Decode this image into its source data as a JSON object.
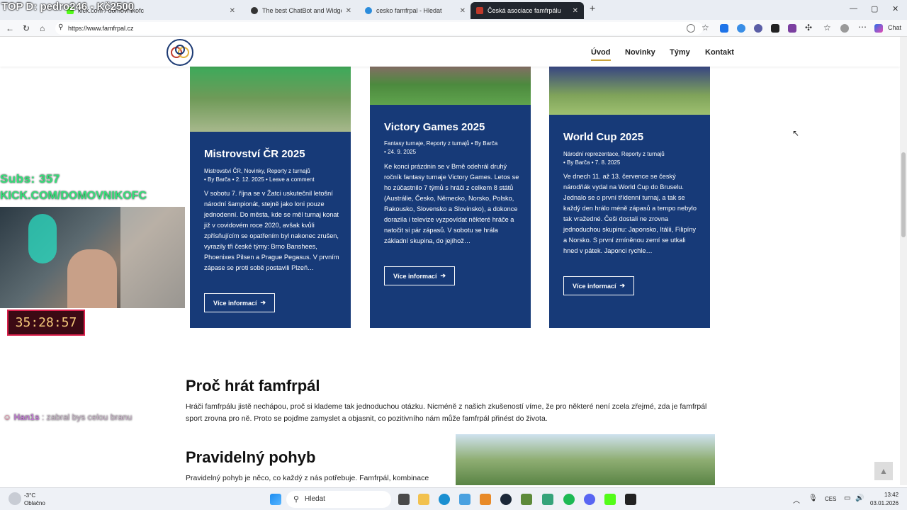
{
  "browser": {
    "tabs": [
      {
        "title": "kick.com / domovnikofc",
        "active": false
      },
      {
        "title": "The best ChatBot and Widgets fo",
        "active": false
      },
      {
        "title": "cesko famfrpal - Hledat",
        "active": false
      },
      {
        "title": "Česká asociace famfrpálu",
        "active": true
      }
    ],
    "new_tab": "+",
    "url": "https://www.famfrpal.cz",
    "chat_label": "Chat"
  },
  "site": {
    "menu": [
      "Úvod",
      "Novinky",
      "Týmy",
      "Kontakt"
    ],
    "active_menu": "Úvod"
  },
  "cards": [
    {
      "title": "Mistrovství ČR 2025",
      "categories": "Mistrovství ČR, Novinky, Reporty z turnajů",
      "byline": "• By Barča • 2. 12. 2025 • Leave a comment",
      "excerpt": "V sobotu 7. října se v Žatci uskutečnil letošní národní šampionát, stejně jako loni pouze jednodenní. Do města, kde se měl turnaj konat již v covidovém roce 2020, avšak kvůli zpřísňujícím se opatřením byl nakonec zrušen, vyrazily tři české týmy: Brno Banshees, Phoenixes Pilsen a Prague Pegasus. V prvním zápase se proti sobě postavili Plzeň…",
      "button": "Více informací"
    },
    {
      "title": "Victory Games 2025",
      "categories": "Fantasy turnaje, Reporty z turnajů • By Barča",
      "byline": "• 24. 9. 2025",
      "excerpt": "Ke konci prázdnin se v Brně odehrál druhý ročník fantasy turnaje Victory Games. Letos se ho zúčastnilo 7 týmů s hráči z celkem 8 států (Austrálie, Česko, Německo, Norsko, Polsko, Rakousko, Slovensko a Slovinsko), a dokonce dorazila i televize vyzpovídat některé hráče a natočit si pár zápasů. V sobotu se hrála základní skupina, do jejíhož…",
      "button": "Více informací"
    },
    {
      "title": "World Cup 2025",
      "categories": "Národní reprezentace, Reporty z turnajů",
      "byline": "• By Barča • 7. 8. 2025",
      "excerpt": "Ve dnech 11. až 13. července se český národňák vydal na World Cup do Bruselu. Jednalo se o první třídenní turnaj, a tak se každý den hrálo méně zápasů a tempo nebylo tak vražedné. Češi dostali ne zrovna jednoduchou skupinu: Japonsko, Itálii, Filipíny a Norsko. S první zmíněnou zemí se utkali hned v pátek. Japonci rychle…",
      "button": "Více informací"
    }
  ],
  "section_why": {
    "heading": "Proč hrát famfrpál",
    "text": "Hráči famfrpálu jistě nechápou, proč si klademe tak jednoduchou otázku. Nicméně z našich zkušeností víme, že pro některé není zcela zřejmé, zda je famfrpál sport zrovna pro ně. Proto se pojďme zamyslet a objasnit, co pozitivního nám může famfrpál přinést do života."
  },
  "section_move": {
    "heading": "Pravidelný pohyb",
    "text": "Pravidelný pohyb je něco, co každý z nás potřebuje. Famfrpál, kombinace"
  },
  "overlay": {
    "top_text": "TOP D: pedro246 - Kč2500",
    "subs": "Subs: 357",
    "kick": "KICK.COM/DOMOVNIKOFC",
    "timer": "35:28:57",
    "chat_user": "Han1s",
    "chat_msg": ": zabral bys celou branu"
  },
  "taskbar": {
    "weather_temp": "-3°C",
    "weather_desc": "Oblačno",
    "search": "Hledat",
    "lang": "CES",
    "time": "13:42",
    "date": "03.01.2026"
  },
  "colors": {
    "card_bg": "#173a78",
    "accent": "#c9a33d",
    "overlay_green": "#35e07a"
  }
}
